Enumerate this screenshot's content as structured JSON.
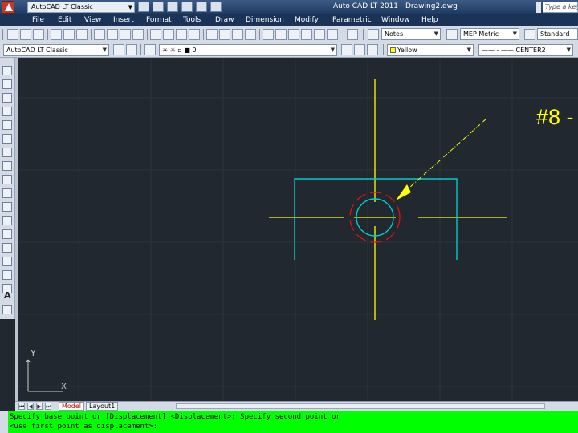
{
  "title_bar": {
    "workspace": "AutoCAD LT Classic",
    "app_title": "Auto CAD LT 2011",
    "document": "Drawing2.dwg",
    "search_placeholder": "Type a keyword"
  },
  "menu": {
    "items": [
      "File",
      "Edit",
      "View",
      "Insert",
      "Format",
      "Tools",
      "Draw",
      "Dimension",
      "Modify",
      "Parametric",
      "Window",
      "Help"
    ]
  },
  "toolbar": {
    "text_style": "Notes",
    "dim_style": "MEP Metric",
    "table_style": "Standard"
  },
  "layers": {
    "workspace": "AutoCAD LT Classic",
    "current_layer": "0",
    "color": "Yellow",
    "linetype": "CENTER2"
  },
  "tools": {
    "text_tool": "A"
  },
  "canvas": {
    "annotation": "#8 -",
    "ucs_y": "Y",
    "ucs_x": "X"
  },
  "tabs": [
    "Model",
    "Layout1"
  ],
  "command_line": [
    "Specify base point or [Displacement] <Displacement>: Specify second point or",
    "<use first point as displacement>:"
  ],
  "colors": {
    "canvas_bg": "#212830",
    "center_line": "#ffff00",
    "object_line": "#00cccc",
    "highlight": "#e01010",
    "command_bg": "#00ff00"
  }
}
